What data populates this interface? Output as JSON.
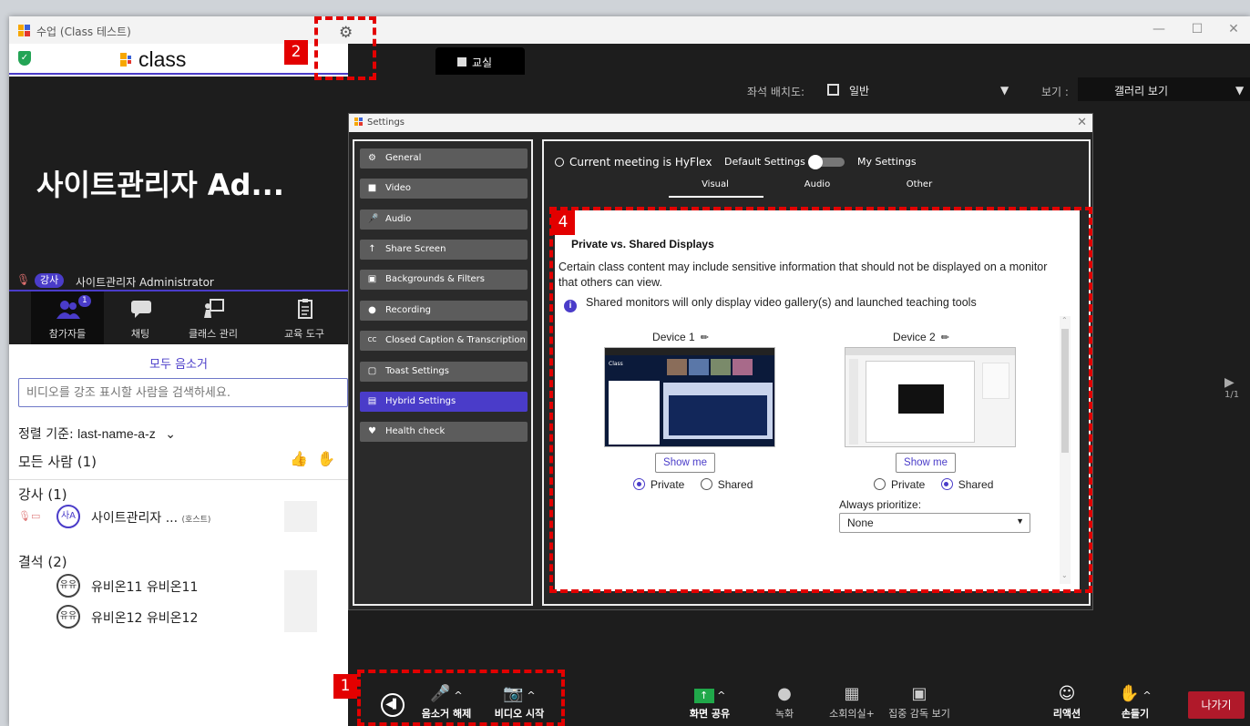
{
  "window": {
    "title": "수업 (Class 테스트)",
    "min": "—",
    "max": "☐",
    "close": "✕"
  },
  "header": {
    "brand": "class",
    "gear_badge": "2"
  },
  "video": {
    "big_name": "사이트관리자 Ad...",
    "role": "강사",
    "name": "사이트관리자 Administrator"
  },
  "tabs": [
    {
      "label": "참가자들",
      "count": "1"
    },
    {
      "label": "채팅"
    },
    {
      "label": "클래스 관리"
    },
    {
      "label": "교육 도구"
    }
  ],
  "participants": {
    "mute_all": "모두 음소거",
    "search_placeholder": "비디오를 강조 표시할 사람을 검색하세요.",
    "sort_label": "정렬 기준:",
    "sort_value": "last-name-a-z",
    "everyone": "모든 사람 (1)",
    "teachers_header": "강사 (1)",
    "teacher": {
      "avatar": "사A",
      "name": "사이트관리자 ...",
      "tag": "(호스트)"
    },
    "absent_header": "결석 (2)",
    "absent": [
      {
        "avatar": "유유",
        "name": "유비온11 유비온11"
      },
      {
        "avatar": "유유",
        "name": "유비온12 유비온12"
      }
    ]
  },
  "room": {
    "tab": "교실",
    "seat_label": "좌석 배치도:",
    "seat_value": "일반",
    "view_label": "보기 :",
    "view_value": "갤러리 보기",
    "page": "1/1"
  },
  "settings": {
    "title": "Settings",
    "menu": [
      {
        "icon": "⚙",
        "label": "General"
      },
      {
        "icon": "■",
        "label": "Video"
      },
      {
        "icon": "🎤",
        "label": "Audio"
      },
      {
        "icon": "↑",
        "label": "Share Screen"
      },
      {
        "icon": "▣",
        "label": "Backgrounds & Filters"
      },
      {
        "icon": "●",
        "label": "Recording"
      },
      {
        "icon": "CC",
        "label": "Closed Caption & Transcription"
      },
      {
        "icon": "▢",
        "label": "Toast Settings"
      },
      {
        "icon": "▤",
        "label": "Hybrid Settings"
      },
      {
        "icon": "♥",
        "label": "Health check"
      }
    ],
    "hyflex": "Current meeting is HyFlex",
    "default_settings": "Default Settings",
    "my_settings": "My Settings",
    "subtabs": [
      "Visual",
      "Audio",
      "Other"
    ],
    "badge4": "4",
    "heading": "Private vs. Shared Displays",
    "description": "Certain class content may include sensitive information that should not be displayed on a monitor that others can view.",
    "info": "Shared monitors will only display video gallery(s) and launched teaching tools",
    "devices": [
      {
        "name": "Device 1",
        "show_me": "Show me",
        "private": "Private",
        "shared": "Shared",
        "selected": "private"
      },
      {
        "name": "Device 2",
        "show_me": "Show me",
        "private": "Private",
        "shared": "Shared",
        "selected": "shared"
      }
    ],
    "always_prioritize": "Always prioritize:",
    "prioritize_value": "None"
  },
  "bottom": {
    "badge1": "1",
    "unmute": "음소거 해제",
    "start_video": "비디오 시작",
    "share": "화면 공유",
    "record": "녹화",
    "breakout": "소회의실+",
    "proctor": "집중 감독 보기",
    "reaction": "리액션",
    "raise_hand": "손들기",
    "leave": "나가기"
  },
  "colors": {
    "accent": "#4a3cc9",
    "annotation": "#e30000",
    "leave": "#b0192a",
    "secure": "#23a455"
  }
}
